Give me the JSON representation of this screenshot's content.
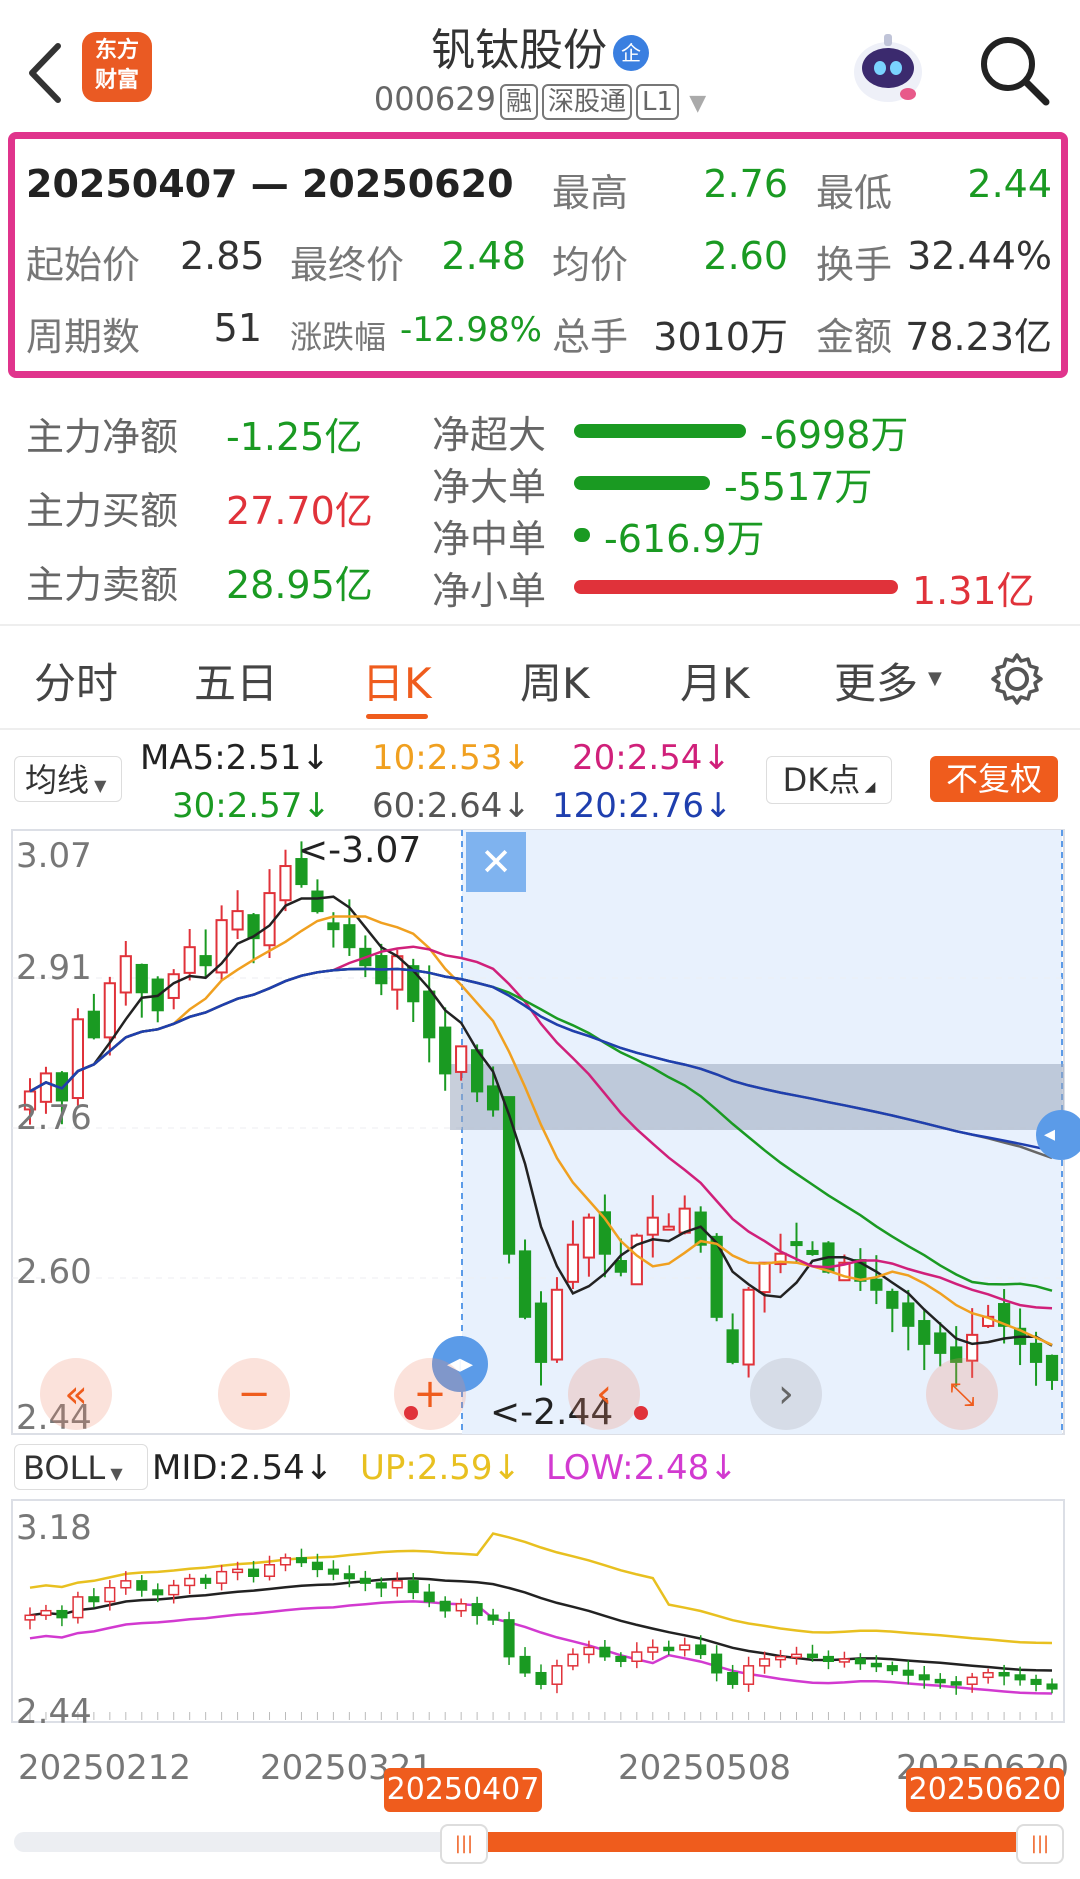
{
  "header": {
    "logo": "东方\n财富",
    "title": "钒钛股份",
    "title_badge": "企",
    "code": "000629",
    "tags": [
      "融",
      "深股通",
      "L1"
    ]
  },
  "summary": {
    "range": "20250407 — 20250620",
    "high_label": "最高",
    "high": "2.76",
    "low_label": "最低",
    "low": "2.44",
    "start_label": "起始价",
    "start": "2.85",
    "end_label": "最终价",
    "end": "2.48",
    "avg_label": "均价",
    "avg": "2.60",
    "turnover_label": "换手",
    "turnover": "32.44%",
    "periods_label": "周期数",
    "periods": "51",
    "change_label": "涨跌幅",
    "change": "-12.98%",
    "volume_label": "总手",
    "volume": "3010万",
    "amount_label": "金额",
    "amount": "78.23亿"
  },
  "flows": {
    "main_net_label": "主力净额",
    "main_net": "-1.25亿",
    "main_buy_label": "主力买额",
    "main_buy": "27.70亿",
    "main_sell_label": "主力卖额",
    "main_sell": "28.95亿",
    "items": [
      {
        "label": "净超大",
        "value": "-6998万",
        "color": "#1a9a22",
        "ratio": 0.53
      },
      {
        "label": "净大单",
        "value": "-5517万",
        "color": "#1a9a22",
        "ratio": 0.42
      },
      {
        "label": "净中单",
        "value": "-616.9万",
        "color": "#1a9a22",
        "ratio": 0.05
      },
      {
        "label": "净小单",
        "value": "1.31亿",
        "color": "#e0323a",
        "ratio": 1.0
      }
    ]
  },
  "tabs": [
    "分时",
    "五日",
    "日K",
    "周K",
    "月K",
    "更多"
  ],
  "active_tab": "日K",
  "indicators": {
    "ma_select": "均线",
    "ma5": "MA5:2.51↓",
    "ma10": "10:2.53↓",
    "ma20": "20:2.54↓",
    "ma30": "30:2.57↓",
    "ma60": "60:2.64↓",
    "ma120": "120:2.76↓",
    "dk_button": "DK点",
    "fq_button": "不复权"
  },
  "main_chart": {
    "y_labels": [
      "3.07",
      "2.91",
      "2.76",
      "2.60",
      "2.44"
    ],
    "high_marker": "<-3.07",
    "low_marker": "<-2.44"
  },
  "boll": {
    "select": "BOLL",
    "mid": "MID:2.54↓",
    "up": "UP:2.59↓",
    "low": "LOW:2.48↓",
    "y_top": "3.18",
    "y_bottom": "2.44"
  },
  "dates": {
    "d1": "20250212",
    "d2": "20250321",
    "d3": "20250508",
    "d4": "20250620",
    "range_start": "20250407",
    "range_end": "20250620"
  },
  "colors": {
    "up": "#e0323a",
    "down": "#1a9a22",
    "accent": "#ef5c1d",
    "ma5": "#222222",
    "ma10": "#f0a020",
    "ma20": "#d0207a",
    "ma30": "#1a9a22",
    "ma60": "#666666",
    "ma120": "#1f3fae",
    "boll_up": "#e8c020",
    "boll_low": "#d23ad0"
  }
}
